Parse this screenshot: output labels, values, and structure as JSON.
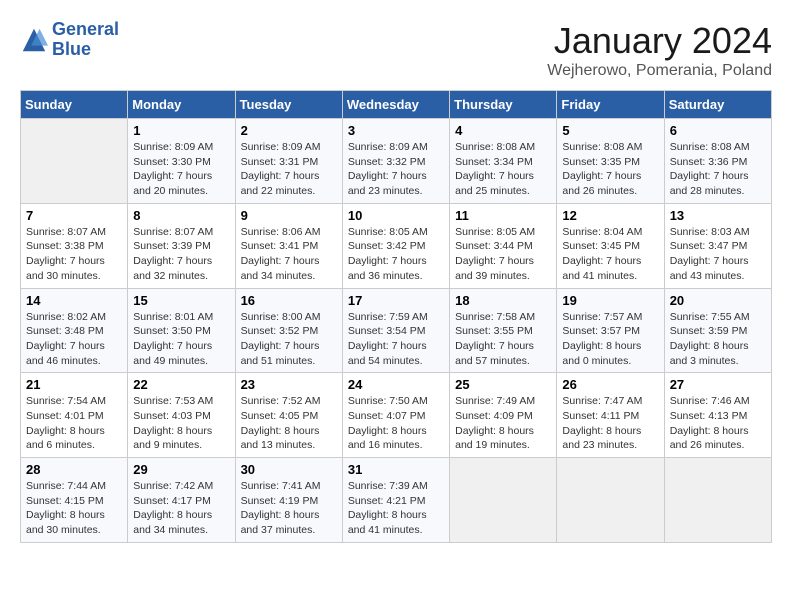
{
  "header": {
    "logo_line1": "General",
    "logo_line2": "Blue",
    "title": "January 2024",
    "subtitle": "Wejherowo, Pomerania, Poland"
  },
  "weekdays": [
    "Sunday",
    "Monday",
    "Tuesday",
    "Wednesday",
    "Thursday",
    "Friday",
    "Saturday"
  ],
  "weeks": [
    [
      {
        "day": "",
        "info": ""
      },
      {
        "day": "1",
        "info": "Sunrise: 8:09 AM\nSunset: 3:30 PM\nDaylight: 7 hours\nand 20 minutes."
      },
      {
        "day": "2",
        "info": "Sunrise: 8:09 AM\nSunset: 3:31 PM\nDaylight: 7 hours\nand 22 minutes."
      },
      {
        "day": "3",
        "info": "Sunrise: 8:09 AM\nSunset: 3:32 PM\nDaylight: 7 hours\nand 23 minutes."
      },
      {
        "day": "4",
        "info": "Sunrise: 8:08 AM\nSunset: 3:34 PM\nDaylight: 7 hours\nand 25 minutes."
      },
      {
        "day": "5",
        "info": "Sunrise: 8:08 AM\nSunset: 3:35 PM\nDaylight: 7 hours\nand 26 minutes."
      },
      {
        "day": "6",
        "info": "Sunrise: 8:08 AM\nSunset: 3:36 PM\nDaylight: 7 hours\nand 28 minutes."
      }
    ],
    [
      {
        "day": "7",
        "info": "Sunrise: 8:07 AM\nSunset: 3:38 PM\nDaylight: 7 hours\nand 30 minutes."
      },
      {
        "day": "8",
        "info": "Sunrise: 8:07 AM\nSunset: 3:39 PM\nDaylight: 7 hours\nand 32 minutes."
      },
      {
        "day": "9",
        "info": "Sunrise: 8:06 AM\nSunset: 3:41 PM\nDaylight: 7 hours\nand 34 minutes."
      },
      {
        "day": "10",
        "info": "Sunrise: 8:05 AM\nSunset: 3:42 PM\nDaylight: 7 hours\nand 36 minutes."
      },
      {
        "day": "11",
        "info": "Sunrise: 8:05 AM\nSunset: 3:44 PM\nDaylight: 7 hours\nand 39 minutes."
      },
      {
        "day": "12",
        "info": "Sunrise: 8:04 AM\nSunset: 3:45 PM\nDaylight: 7 hours\nand 41 minutes."
      },
      {
        "day": "13",
        "info": "Sunrise: 8:03 AM\nSunset: 3:47 PM\nDaylight: 7 hours\nand 43 minutes."
      }
    ],
    [
      {
        "day": "14",
        "info": "Sunrise: 8:02 AM\nSunset: 3:48 PM\nDaylight: 7 hours\nand 46 minutes."
      },
      {
        "day": "15",
        "info": "Sunrise: 8:01 AM\nSunset: 3:50 PM\nDaylight: 7 hours\nand 49 minutes."
      },
      {
        "day": "16",
        "info": "Sunrise: 8:00 AM\nSunset: 3:52 PM\nDaylight: 7 hours\nand 51 minutes."
      },
      {
        "day": "17",
        "info": "Sunrise: 7:59 AM\nSunset: 3:54 PM\nDaylight: 7 hours\nand 54 minutes."
      },
      {
        "day": "18",
        "info": "Sunrise: 7:58 AM\nSunset: 3:55 PM\nDaylight: 7 hours\nand 57 minutes."
      },
      {
        "day": "19",
        "info": "Sunrise: 7:57 AM\nSunset: 3:57 PM\nDaylight: 8 hours\nand 0 minutes."
      },
      {
        "day": "20",
        "info": "Sunrise: 7:55 AM\nSunset: 3:59 PM\nDaylight: 8 hours\nand 3 minutes."
      }
    ],
    [
      {
        "day": "21",
        "info": "Sunrise: 7:54 AM\nSunset: 4:01 PM\nDaylight: 8 hours\nand 6 minutes."
      },
      {
        "day": "22",
        "info": "Sunrise: 7:53 AM\nSunset: 4:03 PM\nDaylight: 8 hours\nand 9 minutes."
      },
      {
        "day": "23",
        "info": "Sunrise: 7:52 AM\nSunset: 4:05 PM\nDaylight: 8 hours\nand 13 minutes."
      },
      {
        "day": "24",
        "info": "Sunrise: 7:50 AM\nSunset: 4:07 PM\nDaylight: 8 hours\nand 16 minutes."
      },
      {
        "day": "25",
        "info": "Sunrise: 7:49 AM\nSunset: 4:09 PM\nDaylight: 8 hours\nand 19 minutes."
      },
      {
        "day": "26",
        "info": "Sunrise: 7:47 AM\nSunset: 4:11 PM\nDaylight: 8 hours\nand 23 minutes."
      },
      {
        "day": "27",
        "info": "Sunrise: 7:46 AM\nSunset: 4:13 PM\nDaylight: 8 hours\nand 26 minutes."
      }
    ],
    [
      {
        "day": "28",
        "info": "Sunrise: 7:44 AM\nSunset: 4:15 PM\nDaylight: 8 hours\nand 30 minutes."
      },
      {
        "day": "29",
        "info": "Sunrise: 7:42 AM\nSunset: 4:17 PM\nDaylight: 8 hours\nand 34 minutes."
      },
      {
        "day": "30",
        "info": "Sunrise: 7:41 AM\nSunset: 4:19 PM\nDaylight: 8 hours\nand 37 minutes."
      },
      {
        "day": "31",
        "info": "Sunrise: 7:39 AM\nSunset: 4:21 PM\nDaylight: 8 hours\nand 41 minutes."
      },
      {
        "day": "",
        "info": ""
      },
      {
        "day": "",
        "info": ""
      },
      {
        "day": "",
        "info": ""
      }
    ]
  ]
}
